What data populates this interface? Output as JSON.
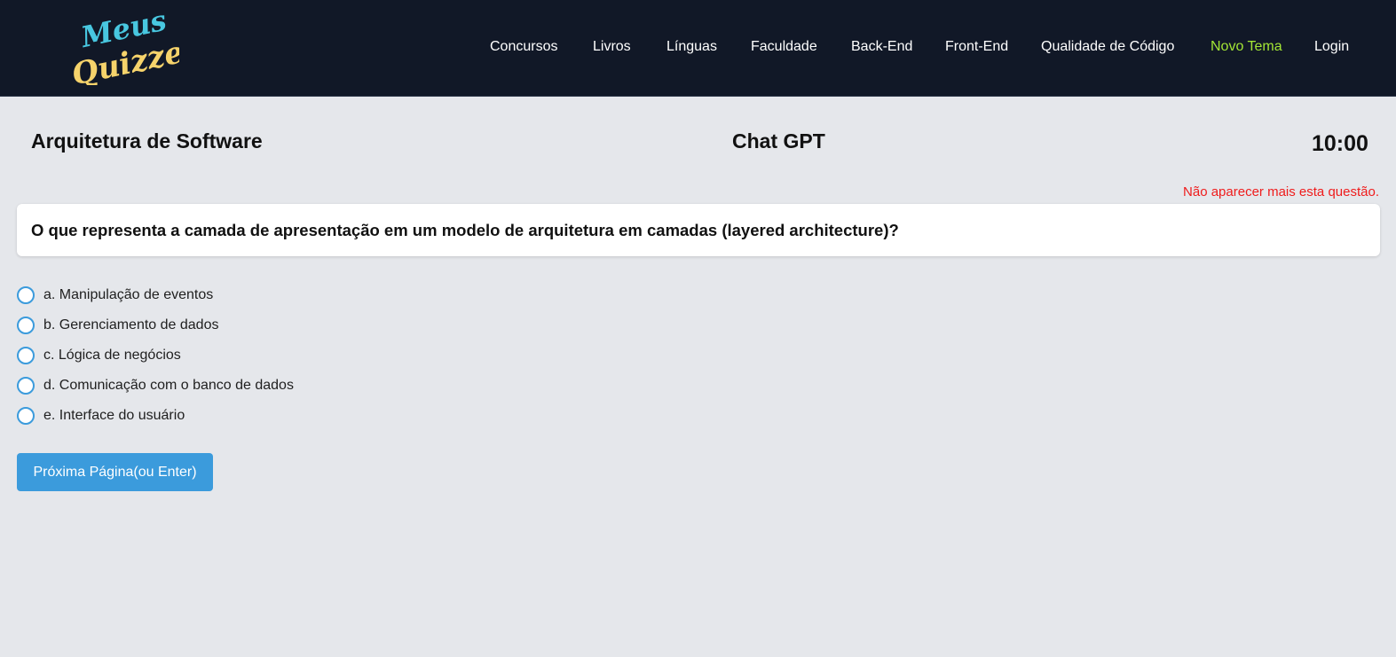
{
  "navbar": {
    "logo": {
      "text_line1": "Meus",
      "text_line2": "Quizzes"
    },
    "links": [
      {
        "label": "Concursos"
      },
      {
        "label": "Livros"
      },
      {
        "label": "Línguas"
      },
      {
        "label": "Faculdade"
      },
      {
        "label": "Back-End"
      },
      {
        "label": "Front-End"
      },
      {
        "label": "Qualidade de Código"
      },
      {
        "label": "Novo Tema"
      },
      {
        "label": "Login"
      }
    ],
    "accent_color": "#a3e635",
    "background_color": "#111827"
  },
  "quiz": {
    "title": "Arquitetura de Software",
    "source": "Chat GPT",
    "timer": "10:00",
    "hide_question_label": "Não aparecer mais esta questão.",
    "question": "O que representa a camada de apresentação em um modelo de arquitetura em camadas (layered architecture)?",
    "options": [
      {
        "label": "a. Manipulação de eventos"
      },
      {
        "label": "b. Gerenciamento de dados"
      },
      {
        "label": "c. Lógica de negócios"
      },
      {
        "label": "d. Comunicação com o banco de dados"
      },
      {
        "label": "e. Interface do usuário"
      }
    ],
    "next_button_label": "Próxima Página(ou Enter)"
  },
  "colors": {
    "primary": "#3b9bdc",
    "warning": "#ef1c1c",
    "page_background": "#e5e7eb"
  }
}
